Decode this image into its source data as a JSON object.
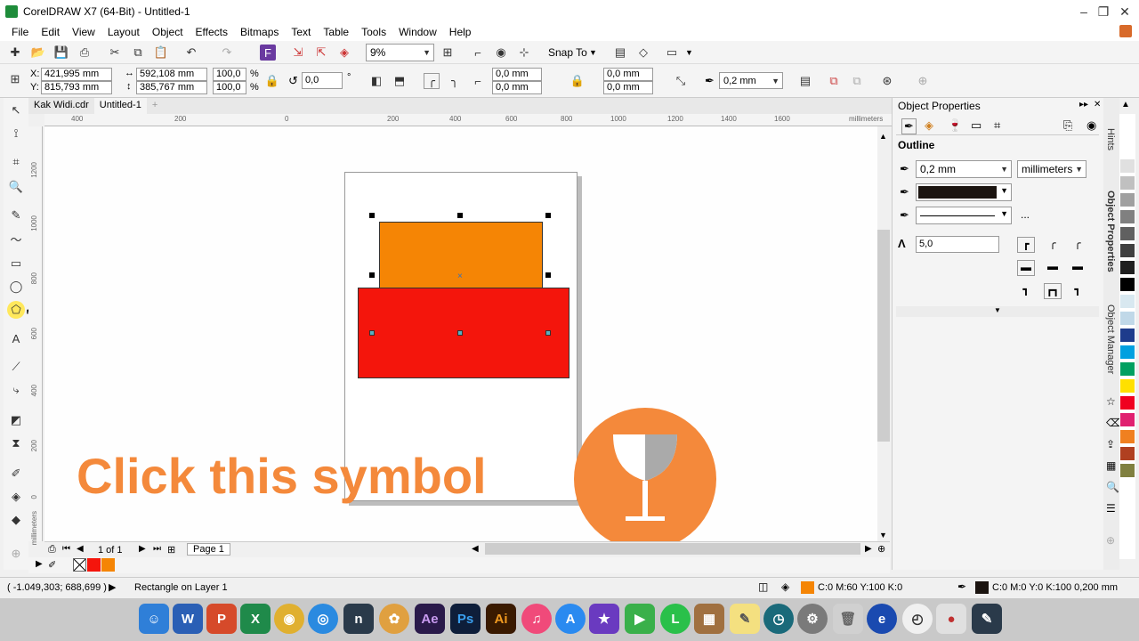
{
  "window": {
    "title": "CorelDRAW X7 (64-Bit) - Untitled-1"
  },
  "menu": [
    "File",
    "Edit",
    "View",
    "Layout",
    "Object",
    "Effects",
    "Bitmaps",
    "Text",
    "Table",
    "Tools",
    "Window",
    "Help"
  ],
  "standard_toolbar": {
    "zoom_level": "9%",
    "snap_to_label": "Snap To"
  },
  "property_bar": {
    "x_label": "X:",
    "x_value": "421,995 mm",
    "y_label": "Y:",
    "y_value": "815,793 mm",
    "width_value": "592,108 mm",
    "height_value": "385,767 mm",
    "scale_w": "100,0",
    "scale_h": "100,0",
    "percent": "%",
    "rotation": "0,0",
    "degree": "°",
    "corner_tl": "0,0 mm",
    "corner_bl": "0,0 mm",
    "corner_tr": "0,0 mm",
    "corner_br": "0,0 mm",
    "outline_width": "0,2 mm"
  },
  "document_tabs": [
    "Kak Widi.cdr",
    "Untitled-1"
  ],
  "ruler": {
    "h_ticks": [
      "400",
      "200",
      "0",
      "200",
      "400",
      "600",
      "800",
      "1000",
      "1200",
      "1400",
      "1600"
    ],
    "h_unit": "millimeters",
    "v_ticks": [
      "1200",
      "1000",
      "800",
      "600",
      "400",
      "200",
      "0"
    ],
    "v_unit": "millimeters"
  },
  "page_nav": {
    "page_count": "1 of 1",
    "page_tab": "Page 1"
  },
  "status": {
    "cursor_pos": "( -1.049,303; 688,699 )",
    "selection_info": "Rectangle on Layer 1",
    "fill_info": "C:0 M:60 Y:100 K:0",
    "outline_info": "C:0 M:0 Y:0 K:100 0,200 mm"
  },
  "object_properties": {
    "title": "Object Properties",
    "section": "Outline",
    "width": "0,2 mm",
    "units": "millimeters",
    "miter_limit": "5,0",
    "more": "..."
  },
  "docker_tabs": [
    "Hints",
    "Object Properties",
    "Object Manager"
  ],
  "overlay": {
    "instruction": "Click this symbol"
  },
  "colors": {
    "orange_rect": "#f58505",
    "red_rect": "#f4150c",
    "overlay_orange": "#f4893b",
    "outline_color": "#1b1410"
  },
  "palette": [
    "#ffffff",
    "#e0e0e0",
    "#c0c0c0",
    "#a0a0a0",
    "#808080",
    "#606060",
    "#404040",
    "#202020",
    "#000000",
    "#d8e8f0",
    "#c0d8e8",
    "#1e3c8c",
    "#00a0e0",
    "#00a060",
    "#ffe000",
    "#f00020",
    "#e02070",
    "#f08020",
    "#b04020",
    "#808040"
  ]
}
